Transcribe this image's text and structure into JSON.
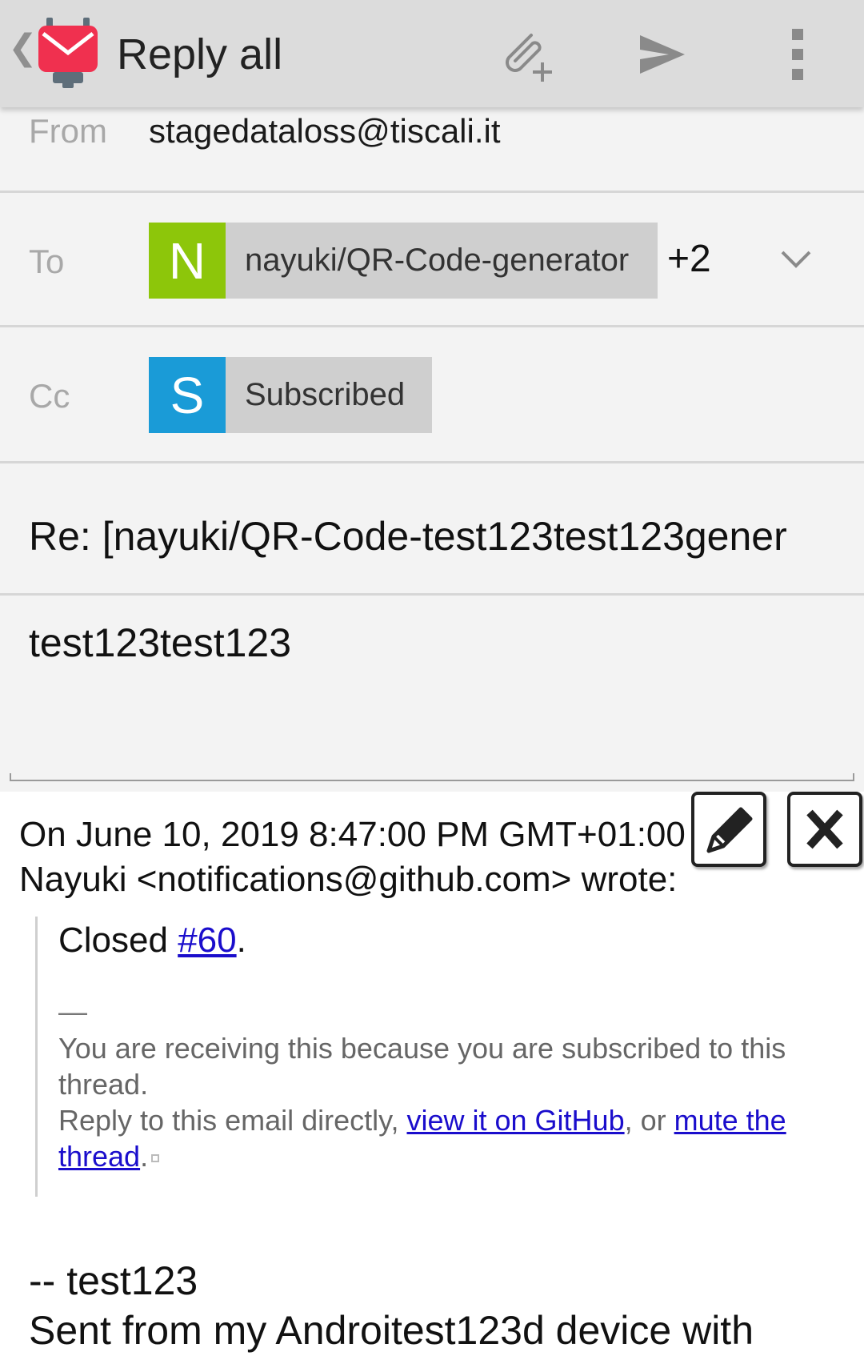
{
  "appbar": {
    "title": "Reply all",
    "back_glyph": "❮",
    "icons": [
      "app-logo-icon",
      "attach-icon",
      "send-icon",
      "overflow-menu-icon"
    ]
  },
  "from": {
    "label": "From",
    "value": "stagedataloss@tiscali.it"
  },
  "to": {
    "label": "To",
    "chip": {
      "initial": "N",
      "name": "nayuki/QR-Code-generator",
      "color": "#8dc60a"
    },
    "more": "+2"
  },
  "cc": {
    "label": "Cc",
    "chip": {
      "initial": "S",
      "name": "Subscribed",
      "color": "#1a9bd7"
    }
  },
  "subject": "Re: [nayuki/QR-Code-test123test123gener",
  "body": "test123test123",
  "quote": {
    "header_line1": "On June 10, 2019 8:47:00 PM GMT+01:00",
    "header_line2": "Nayuki <notifications@github.com> wrote:",
    "closed_prefix": "Closed ",
    "closed_link": "#60",
    "closed_suffix": ".",
    "dash": "—",
    "receiving": "You are receiving this because you are subscribed to this thread.",
    "reply_prefix": "Reply to this email directly, ",
    "view_link": "view it on GitHub",
    "reply_mid": ", or ",
    "mute_link": "mute the thread",
    "reply_suffix": "."
  },
  "signature": {
    "line1": "-- test123",
    "line2": "Sent from my Androitest123d device with"
  }
}
